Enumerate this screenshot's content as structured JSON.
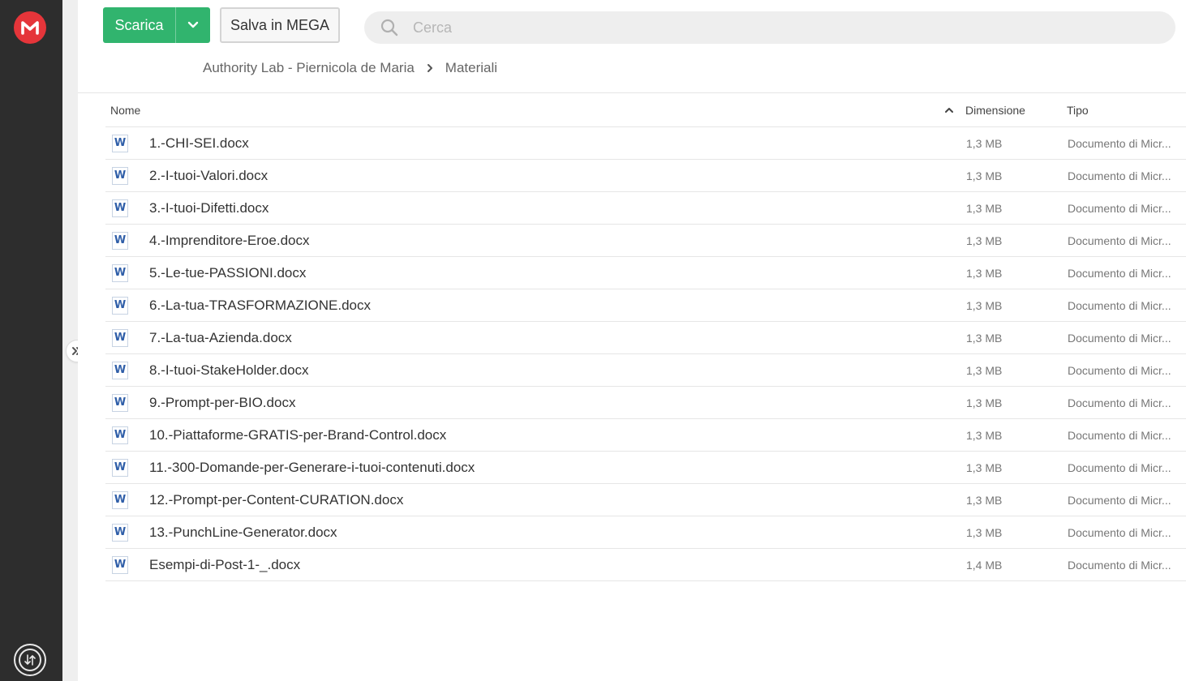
{
  "app": {
    "logo_icon": "mega-logo-icon",
    "brand_color": "#e5353a",
    "accent_color": "#31b46e"
  },
  "toolbar": {
    "download_label": "Scarica",
    "save_label": "Salva in MEGA",
    "search_placeholder": "Cerca"
  },
  "breadcrumb": {
    "items": [
      "Authority Lab - Piernicola de Maria",
      "Materiali"
    ]
  },
  "table": {
    "columns": {
      "name": "Nome",
      "size": "Dimensione",
      "type": "Tipo"
    },
    "sort": "name-ascending",
    "rows": [
      {
        "name": "1.-CHI-SEI.docx",
        "size": "1,3 MB",
        "type": "Documento di Micr..."
      },
      {
        "name": "2.-I-tuoi-Valori.docx",
        "size": "1,3 MB",
        "type": "Documento di Micr..."
      },
      {
        "name": "3.-I-tuoi-Difetti.docx",
        "size": "1,3 MB",
        "type": "Documento di Micr..."
      },
      {
        "name": "4.-Imprenditore-Eroe.docx",
        "size": "1,3 MB",
        "type": "Documento di Micr..."
      },
      {
        "name": "5.-Le-tue-PASSIONI.docx",
        "size": "1,3 MB",
        "type": "Documento di Micr..."
      },
      {
        "name": "6.-La-tua-TRASFORMAZIONE.docx",
        "size": "1,3 MB",
        "type": "Documento di Micr..."
      },
      {
        "name": "7.-La-tua-Azienda.docx",
        "size": "1,3 MB",
        "type": "Documento di Micr..."
      },
      {
        "name": "8.-I-tuoi-StakeHolder.docx",
        "size": "1,3 MB",
        "type": "Documento di Micr..."
      },
      {
        "name": "9.-Prompt-per-BIO.docx",
        "size": "1,3 MB",
        "type": "Documento di Micr..."
      },
      {
        "name": "10.-Piattaforme-GRATIS-per-Brand-Control.docx",
        "size": "1,3 MB",
        "type": "Documento di Micr..."
      },
      {
        "name": "11.-300-Domande-per-Generare-i-tuoi-contenuti.docx",
        "size": "1,3 MB",
        "type": "Documento di Micr..."
      },
      {
        "name": "12.-Prompt-per-Content-CURATION.docx",
        "size": "1,3 MB",
        "type": "Documento di Micr..."
      },
      {
        "name": "13.-PunchLine-Generator.docx",
        "size": "1,3 MB",
        "type": "Documento di Micr..."
      },
      {
        "name": "Esempi-di-Post-1-_.docx",
        "size": "1,4 MB",
        "type": "Documento di Micr..."
      }
    ]
  }
}
